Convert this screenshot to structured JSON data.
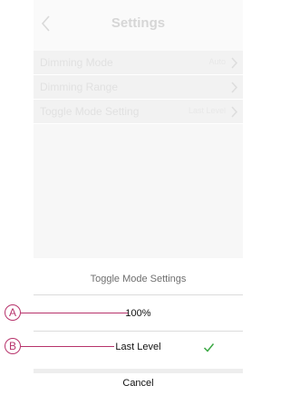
{
  "header": {
    "title": "Settings",
    "back_icon": "chevron-left-icon"
  },
  "settings": {
    "rows": [
      {
        "label": "Dimming Mode",
        "value": "Auto"
      },
      {
        "label": "Dimming Range",
        "value": ""
      },
      {
        "label": "Toggle Mode Setting",
        "value": "Last Level"
      }
    ]
  },
  "sheet": {
    "title": "Toggle Mode Settings",
    "options": [
      {
        "label": "100%",
        "selected": false
      },
      {
        "label": "Last Level",
        "selected": true
      }
    ],
    "cancel_label": "Cancel"
  },
  "callouts": [
    {
      "letter": "A",
      "target": "100%"
    },
    {
      "letter": "B",
      "target": "Last Level"
    }
  ],
  "colors": {
    "accent": "#b7336b",
    "check": "#3aa843",
    "muted_text": "#e1e1e1"
  }
}
